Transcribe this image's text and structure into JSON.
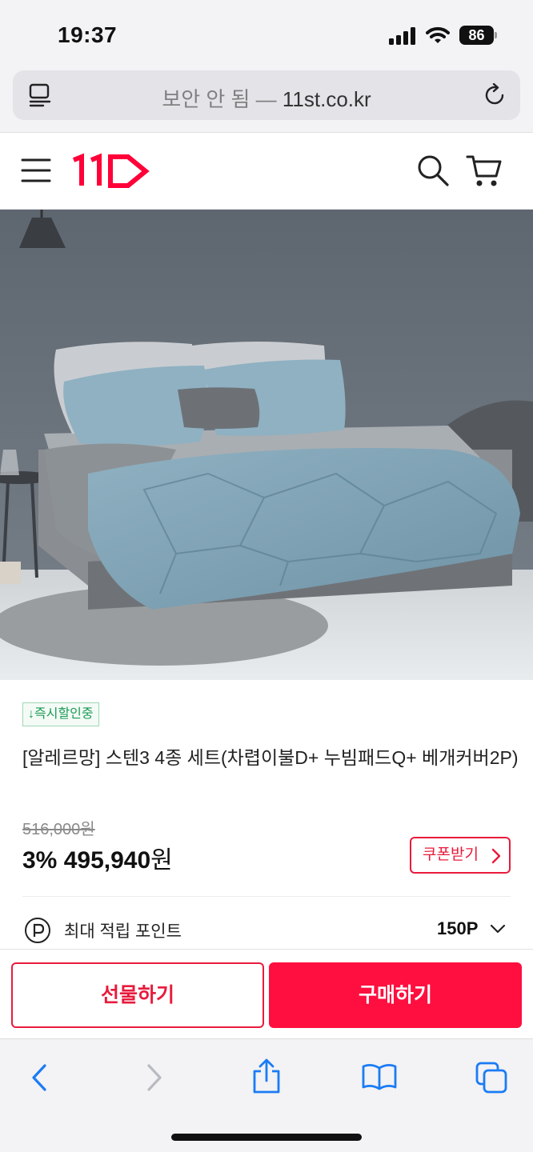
{
  "status_bar": {
    "time": "19:37",
    "battery": "86",
    "icons": [
      "signal-icon",
      "wifi-icon",
      "battery-icon"
    ]
  },
  "browser": {
    "url_prefix": "보안 안 됨 — ",
    "url_domain": "11st.co.kr",
    "icons": [
      "reader-icon",
      "reload-icon"
    ]
  },
  "site_header": {
    "logo": "11",
    "icons": [
      "menu-icon",
      "search-icon",
      "cart-icon"
    ],
    "brand_color": "#ff0038"
  },
  "product": {
    "badge": "↓즉시할인중",
    "title": "[알레르망] 스텐3 4종 세트(차렵이불D+ 누빔패드Q+ 베개커버2P)",
    "original_price": "516,000원",
    "discount": "3%",
    "price": "495,940",
    "currency": "원",
    "coupon_label": "쿠폰받기",
    "point_label": "최대 적립 포인트",
    "point_value": "150P"
  },
  "actions": {
    "gift_label": "선물하기",
    "buy_label": "구매하기",
    "accent_color": "#ff0f3f"
  },
  "toolbar": {
    "icons": [
      "back-icon",
      "forward-icon",
      "share-icon",
      "bookmarks-icon",
      "tabs-icon"
    ]
  }
}
